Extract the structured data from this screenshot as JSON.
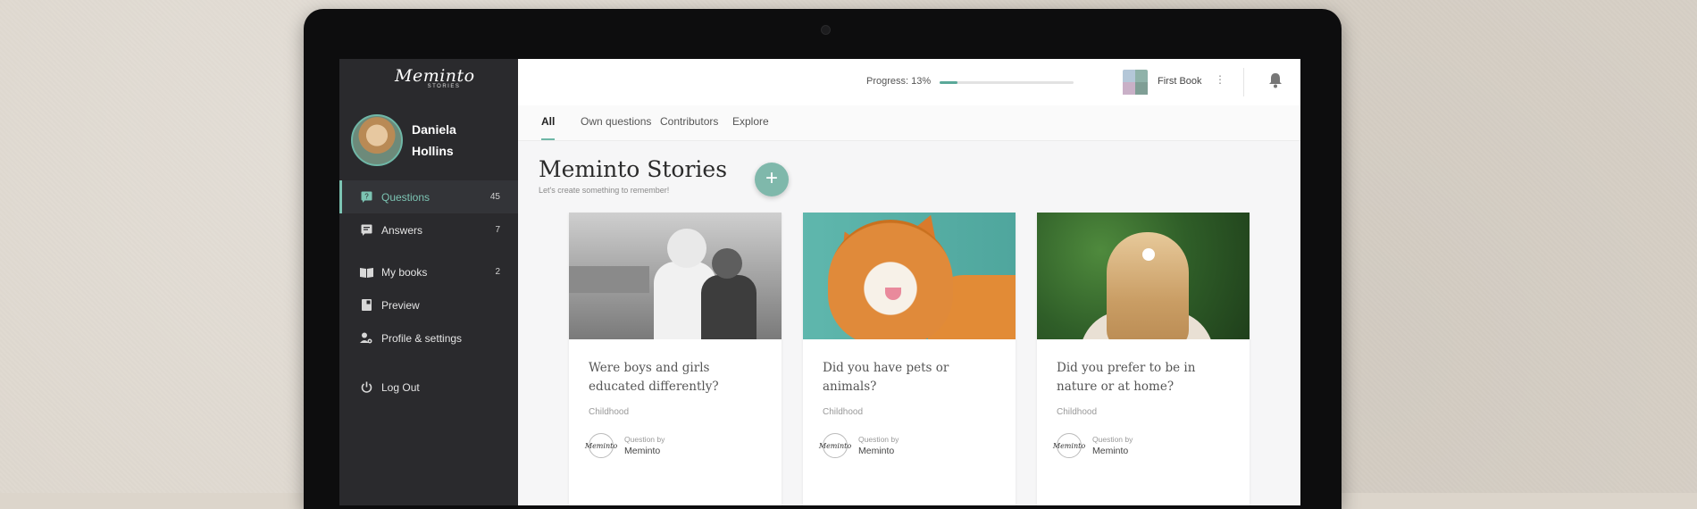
{
  "sidebar": {
    "logo_main": "Meminto",
    "logo_sub": "STORIES",
    "user_first": "Daniela",
    "user_last": "Hollins",
    "items": [
      {
        "label": "Questions",
        "count": "45",
        "icon": "question-icon"
      },
      {
        "label": "Answers",
        "count": "7",
        "icon": "answer-icon"
      },
      {
        "label": "My books",
        "count": "2",
        "icon": "book-icon"
      },
      {
        "label": "Preview",
        "icon": "preview-icon"
      },
      {
        "label": "Profile & settings",
        "icon": "profile-settings-icon"
      },
      {
        "label": "Log Out",
        "icon": "power-icon"
      }
    ]
  },
  "topbar": {
    "progress_label": "Progress: 13%",
    "progress_value": 13,
    "book_name": "First Book",
    "book_menu": "⋮"
  },
  "tabs": [
    "All",
    "Own questions",
    "Contributors",
    "Explore"
  ],
  "main": {
    "title": "Meminto Stories",
    "subtitle": "Let's create something to remember!",
    "add_label": "+"
  },
  "cards": [
    {
      "title": "Were boys and girls educated differently?",
      "category": "Childhood",
      "by_label": "Question by",
      "author": "Meminto",
      "author_logo": "Meminto"
    },
    {
      "title": "Did you have pets or animals?",
      "category": "Childhood",
      "by_label": "Question by",
      "author": "Meminto",
      "author_logo": "Meminto"
    },
    {
      "title": "Did you prefer to be in nature or at home?",
      "category": "Childhood",
      "by_label": "Question by",
      "author": "Meminto",
      "author_logo": "Meminto"
    }
  ],
  "colors": {
    "accent": "#6fb7a7",
    "sidebar": "#2a2a2d",
    "fab": "#7fb8ab"
  }
}
